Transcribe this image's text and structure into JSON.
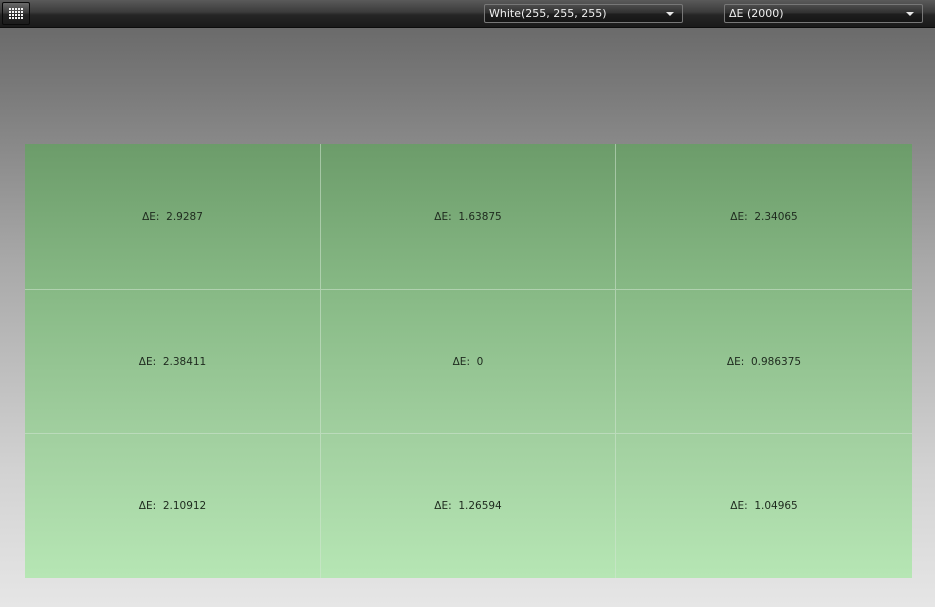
{
  "toolbar": {
    "grid_button_icon": "grid-icon",
    "reference_color": "White(255, 255, 255)",
    "metric": "ΔE (2000)"
  },
  "patches": [
    {
      "label": "ΔE:",
      "value": "2.9287"
    },
    {
      "label": "ΔE:",
      "value": "1.63875"
    },
    {
      "label": "ΔE:",
      "value": "2.34065"
    },
    {
      "label": "ΔE:",
      "value": "2.38411"
    },
    {
      "label": "ΔE:",
      "value": "0"
    },
    {
      "label": "ΔE:",
      "value": "0.986375"
    },
    {
      "label": "ΔE:",
      "value": "2.10912"
    },
    {
      "label": "ΔE:",
      "value": "1.26594"
    },
    {
      "label": "ΔE:",
      "value": "1.04965"
    }
  ],
  "colors": {
    "patch_top": "#6c9c6a",
    "patch_bottom": "#b6e6b4",
    "toolbar": "#262626"
  }
}
